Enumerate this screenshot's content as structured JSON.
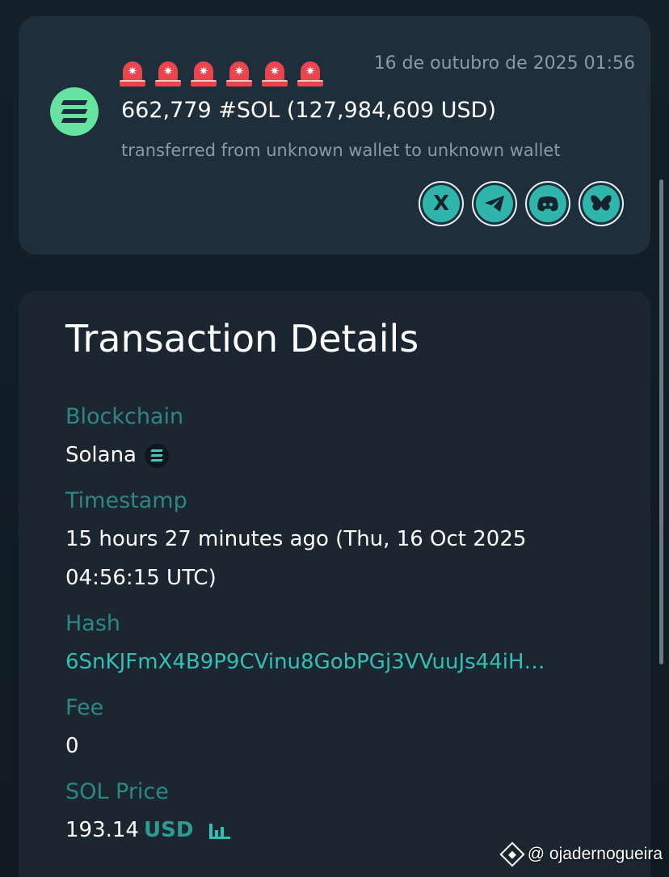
{
  "alert": {
    "date": "16 de outubro de 2025 01:56",
    "amount_line": "662,779 #SOL (127,984,609 USD)",
    "transfer_line": "transferred from unknown wallet to unknown wallet",
    "alarm_count": 6,
    "alarm_icon": "🚨",
    "token_icon": "solana-icon",
    "socials": [
      {
        "icon": "x-icon",
        "glyph": "𝕏"
      },
      {
        "icon": "telegram-icon",
        "glyph": "➤"
      },
      {
        "icon": "discord-icon",
        "glyph": "☺"
      },
      {
        "icon": "bluesky-icon",
        "glyph": "🦋"
      }
    ]
  },
  "details": {
    "title": "Transaction Details",
    "blockchain_label": "Blockchain",
    "blockchain_value": "Solana",
    "timestamp_label": "Timestamp",
    "timestamp_value_1": "15 hours 27 minutes ago (Thu, 16 Oct 2025",
    "timestamp_value_2": "04:56:15 UTC)",
    "hash_label": "Hash",
    "hash_value": "6SnKJFmX4B9P9CVinu8GobPGj3VVuuJs44iH…",
    "fee_label": "Fee",
    "fee_value": "0",
    "price_label": "SOL Price",
    "price_value": "193.14",
    "price_unit": "USD"
  },
  "watermark": {
    "handle": "@ ojadernogueira"
  },
  "colors": {
    "accent": "#2fb5a9",
    "label": "#2f8783",
    "card": "#1e2e3b",
    "alarm": "#e8454f",
    "solana_badge": "#66e3a0"
  }
}
